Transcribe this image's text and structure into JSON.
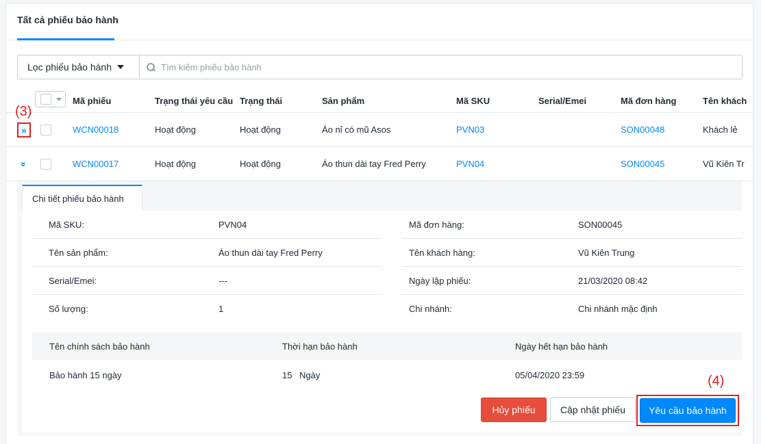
{
  "tabs": {
    "all_label": "Tất cả phiếu bảo hành"
  },
  "filter": {
    "label": "Lọc phiếu bảo hành"
  },
  "search": {
    "placeholder": "Tìm kiếm phiếu bảo hành"
  },
  "table": {
    "headers": [
      "Mã phiếu",
      "Trạng thái yêu cầu",
      "Trạng thái",
      "Sản phẩm",
      "Mã SKU",
      "Serial/Emei",
      "Mã đơn hàng",
      "Tên khách"
    ],
    "rows": [
      {
        "code": "WCN00018",
        "request_status": "Hoạt động",
        "status": "Hoạt động",
        "product": "Áo nỉ có mũ Asos",
        "sku": "PVN03",
        "serial": "",
        "order": "SON00048",
        "customer": "Khách lẻ"
      },
      {
        "code": "WCN00017",
        "request_status": "Hoạt động",
        "status": "Hoạt động",
        "product": "Áo thun dài tay Fred Perry",
        "sku": "PVN04",
        "serial": "",
        "order": "SON00045",
        "customer": "Vũ Kiên Tr"
      }
    ]
  },
  "detail": {
    "tab_label": "Chi tiết phiếu bảo hành",
    "left": [
      {
        "label": "Mã SKU:",
        "value": "PVN04"
      },
      {
        "label": "Tên sản phẩm:",
        "value": "Áo thun dài tay Fred Perry"
      },
      {
        "label": "Serial/Emei:",
        "value": "---"
      },
      {
        "label": "Số lượng:",
        "value": "1"
      }
    ],
    "right": [
      {
        "label": "Mã đơn hàng:",
        "value": "SON00045"
      },
      {
        "label": "Tên khách hàng:",
        "value": "Vũ Kiên Trung"
      },
      {
        "label": "Ngày lập phiếu:",
        "value": "21/03/2020 08:42"
      },
      {
        "label": "Chi nhánh:",
        "value": "Chi nhánh mặc định"
      }
    ],
    "policy_headers": [
      "Tên chính sách bảo hành",
      "Thời hạn bảo hành",
      "Ngày hết hạn bảo hành"
    ],
    "policy_row": {
      "name": "Bảo hành 15 ngày",
      "duration_num": "15",
      "duration_unit": "Ngày",
      "expiry": "05/04/2020 23:59"
    }
  },
  "buttons": {
    "cancel": "Hủy phiếu",
    "update": "Cập nhật phiếu",
    "request": "Yêu cầu bảo hành"
  },
  "annotations": {
    "step3": "(3)",
    "step4": "(4)"
  },
  "colors": {
    "accent": "#0088ff",
    "danger": "#e74c3c",
    "annotation": "#e02020"
  }
}
